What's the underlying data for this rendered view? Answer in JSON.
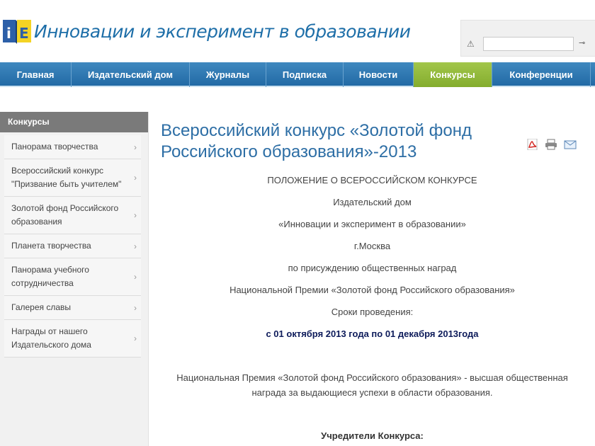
{
  "header": {
    "logo_text": "iE",
    "title": "Инновации и эксперимент в образовании",
    "search": {
      "placeholder": "",
      "warning_icon": "warning-icon",
      "key_icon": "key-icon"
    }
  },
  "nav": {
    "items": [
      {
        "label": "Главная",
        "active": false
      },
      {
        "label": "Издательский дом",
        "active": false
      },
      {
        "label": "Журналы",
        "active": false
      },
      {
        "label": "Подписка",
        "active": false
      },
      {
        "label": "Новости",
        "active": false
      },
      {
        "label": "Конкурсы",
        "active": true
      },
      {
        "label": "Конференции",
        "active": false
      }
    ]
  },
  "sidebar": {
    "heading": "Конкурсы",
    "items": [
      {
        "label": "Панорама творчества"
      },
      {
        "label": "Всероссийский конкурс \"Призвание быть учителем\""
      },
      {
        "label": "Золотой фонд Российского образования"
      },
      {
        "label": "Планета творчества"
      },
      {
        "label": "Панорама учебного сотрудничества"
      },
      {
        "label": "Галерея славы"
      },
      {
        "label": "Награды от нашего Издательского дома"
      }
    ]
  },
  "article": {
    "title": "Всероссийский конкурс «Золотой фонд Российского образования»-2013",
    "tools": {
      "pdf": "pdf-icon",
      "print": "print-icon",
      "email": "email-icon"
    },
    "lines": [
      "ПОЛОЖЕНИЕ О ВСЕРОССИЙСКОМ КОНКУРСЕ",
      "Издательский дом",
      "«Инновации и эксперимент в образовании»",
      "г.Москва",
      "по присуждению общественных наград",
      "Национальной Премии «Золотой фонд Российского образования»",
      "Сроки проведения:"
    ],
    "dates": "с 01 октября 2013 года по 01 декабря 2013года",
    "paragraph": "Национальная Премия «Золотой фонд Российского образования» - высшая общественная награда за выдающиеся успехи в области образования.",
    "founders_heading": "Учредители Конкурса:"
  },
  "colors": {
    "nav_blue": "#2b73ad",
    "nav_active_green": "#95ba3c",
    "title_blue": "#2d6ea5",
    "dates_navy": "#0d1b5a"
  }
}
